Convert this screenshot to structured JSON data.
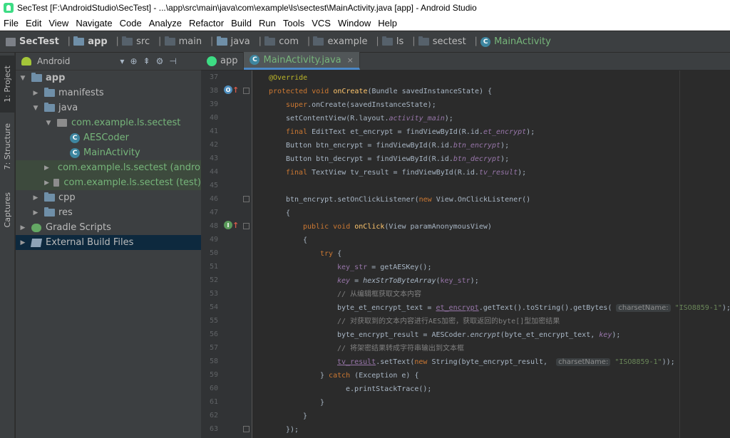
{
  "window": {
    "title": "SecTest [F:\\AndroidStudio\\SecTest] - ...\\app\\src\\main\\java\\com\\example\\ls\\sectest\\MainActivity.java [app] - Android Studio"
  },
  "menu": [
    "File",
    "Edit",
    "View",
    "Navigate",
    "Code",
    "Analyze",
    "Refactor",
    "Build",
    "Run",
    "Tools",
    "VCS",
    "Window",
    "Help"
  ],
  "breadcrumb": [
    "SecTest",
    "app",
    "src",
    "main",
    "java",
    "com",
    "example",
    "ls",
    "sectest",
    "MainActivity"
  ],
  "side_tabs": [
    "1: Project",
    "7: Structure",
    "Captures"
  ],
  "project_panel": {
    "view_selector": "Android",
    "tree": [
      {
        "label": "app",
        "depth": 0,
        "expanded": true,
        "icon": "folder-icon"
      },
      {
        "label": "manifests",
        "depth": 1,
        "expanded": false,
        "icon": "folder-icon"
      },
      {
        "label": "java",
        "depth": 1,
        "expanded": true,
        "icon": "folder-icon"
      },
      {
        "label": "com.example.ls.sectest",
        "depth": 2,
        "expanded": true,
        "icon": "package-icon"
      },
      {
        "label": "AESCoder",
        "depth": 3,
        "icon": "class-icon"
      },
      {
        "label": "MainActivity",
        "depth": 3,
        "icon": "class-icon"
      },
      {
        "label": "com.example.ls.sectest (androi",
        "depth": 2,
        "expanded": false,
        "icon": "package-icon"
      },
      {
        "label": "com.example.ls.sectest (test)",
        "depth": 2,
        "expanded": false,
        "icon": "package-icon"
      },
      {
        "label": "cpp",
        "depth": 1,
        "expanded": false,
        "icon": "folder-icon"
      },
      {
        "label": "res",
        "depth": 1,
        "expanded": false,
        "icon": "folder-icon"
      },
      {
        "label": "Gradle Scripts",
        "depth": 0,
        "expanded": false,
        "icon": "gradle-icon"
      },
      {
        "label": "External Build Files",
        "depth": 0,
        "expanded": false,
        "icon": "build-icon"
      }
    ]
  },
  "editor_tabs": [
    {
      "label": "app"
    },
    {
      "label": "MainActivity.java",
      "close": "×"
    }
  ],
  "code": {
    "line_numbers": [
      "37",
      "38",
      "39",
      "40",
      "41",
      "42",
      "43",
      "44",
      "45",
      "46",
      "47",
      "48",
      "49",
      "50",
      "51",
      "52",
      "53",
      "54",
      "55",
      "56",
      "57",
      "58",
      "59",
      "60",
      "61",
      "62",
      "63"
    ],
    "l37": "@Override",
    "l38_kw": "protected void ",
    "l38_fn": "onCreate",
    "l38_rest": "(Bundle savedInstanceState) {",
    "l39_kw": "super",
    "l39_rest": ".onCreate(savedInstanceState);",
    "l40_a": "setContentView(R.layout.",
    "l40_f": "activity_main",
    "l40_b": ");",
    "l41_kw": "final ",
    "l41_a": "EditText et_encrypt = findViewById(R.id.",
    "l41_f": "et_encrypt",
    "l41_b": ");",
    "l42_a": "Button btn_encrypt = findViewById(R.id.",
    "l42_f": "btn_encrypt",
    "l42_b": ");",
    "l43_a": "Button btn_decrypt = findViewById(R.id.",
    "l43_f": "btn_decrypt",
    "l43_b": ");",
    "l44_kw": "final ",
    "l44_a": "TextView tv_result = findViewById(R.id.",
    "l44_f": "tv_result",
    "l44_b": ");",
    "l46_a": "btn_encrypt.setOnClickListener(",
    "l46_kw": "new ",
    "l46_b": "View.OnClickListener()",
    "l47": "{",
    "l48_kw": "public void ",
    "l48_fn": "onClick",
    "l48_rest": "(View paramAnonymousView)",
    "l49": "{",
    "l50_kw": "try ",
    "l50_rest": "{",
    "l51_v": "key_str",
    "l51_rest": " = getAESKey();",
    "l52_v": "key",
    "l52_a": " = ",
    "l52_s": "hexStrToByteArray",
    "l52_b": "(",
    "l52_v2": "key_str",
    "l52_c": ");",
    "l53": "// 从编辑框获取文本内容",
    "l54_a": "byte_et_encrypt_text = ",
    "l54_u": "et_encrypt",
    "l54_b": ".getText().toString().getBytes( ",
    "l54_hint": "charsetName:",
    "l54_str": " \"ISO8859-1\"",
    "l54_c": ");",
    "l55": "// 对获取到的文本内容进行AES加密，获取返回的byte[]型加密结果",
    "l56_a": "byte_encrypt_result = AESCoder.",
    "l56_s": "encrypt",
    "l56_b": "(byte_et_encrypt_text, ",
    "l56_v": "key",
    "l56_c": ");",
    "l57": "// 将架密结果转成字符串输出到文本框",
    "l58_u": "tv_result",
    "l58_a": ".setText(",
    "l58_kw": "new ",
    "l58_b": "String(byte_encrypt_result,  ",
    "l58_hint": "charsetName:",
    "l58_str": " \"ISO8859-1\"",
    "l58_c": "));",
    "l59_a": "} ",
    "l59_kw": "catch ",
    "l59_b": "(Exception e) {",
    "l60": "e.printStackTrace();",
    "l61": "}",
    "l62": "}",
    "l63": "});"
  },
  "colors": {
    "keyword": "#cc7832",
    "method": "#ffc66d",
    "field": "#9876aa",
    "string": "#6a8759",
    "comment": "#808080",
    "annotation": "#bbb529",
    "selection": "#0d293e"
  }
}
